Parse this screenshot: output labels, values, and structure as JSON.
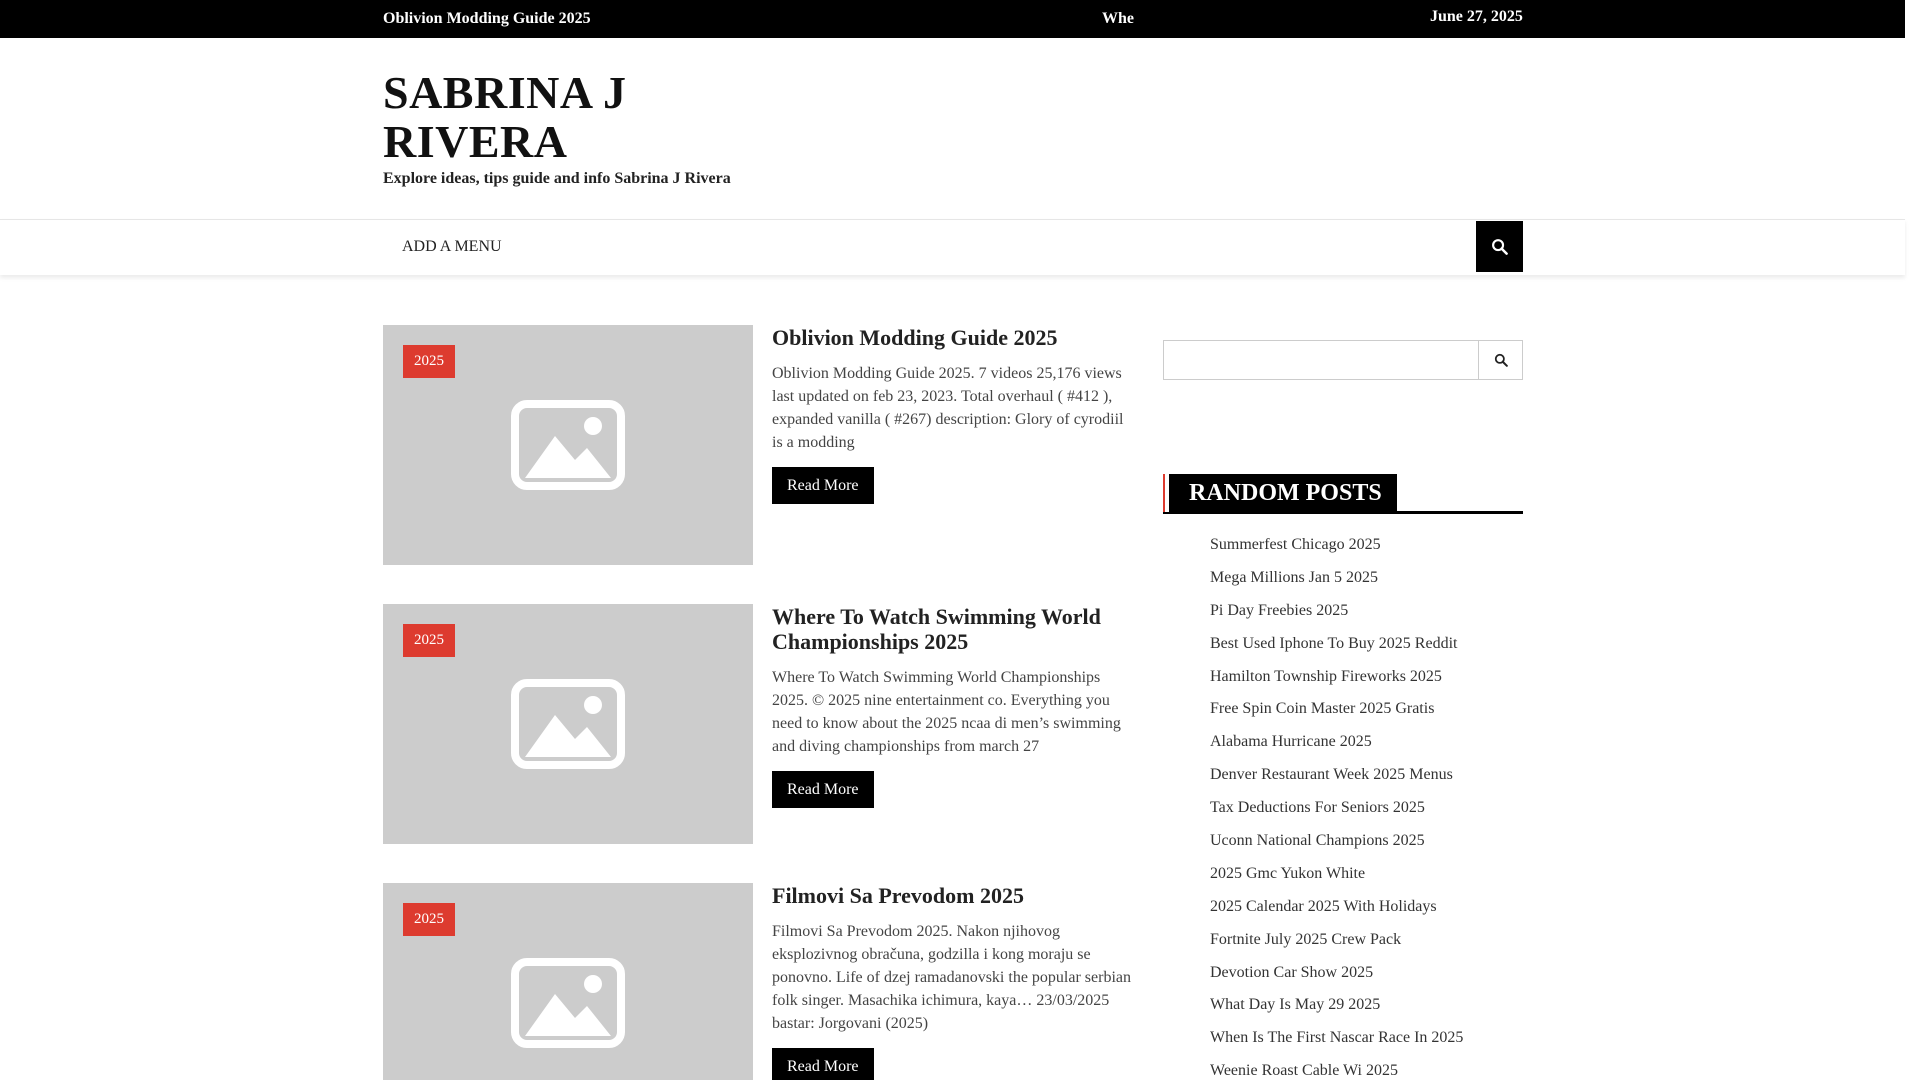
{
  "topbar": {
    "latest_title": "Oblivion Modding Guide 2025",
    "ticker_text": "Whe",
    "date": "June 27, 2025"
  },
  "site": {
    "title": "SABRINA J RIVERA",
    "tagline": "Explore ideas, tips guide and info Sabrina J Rivera"
  },
  "nav": {
    "menu_label": "ADD A MENU"
  },
  "posts": [
    {
      "category": "2025",
      "title": "Oblivion Modding Guide 2025",
      "excerpt": "Oblivion Modding Guide 2025. 7 videos 25,176 views last updated on feb 23, 2023. Total overhaul ( #412 ), expanded vanilla ( #267) description: Glory of cyrodiil is a modding",
      "read_more": "Read More"
    },
    {
      "category": "2025",
      "title": "Where To Watch Swimming World Championships 2025",
      "excerpt": "Where To Watch Swimming World Championships 2025. © 2025 nine entertainment co. Everything you need to know about the 2025 ncaa di men’s swimming and diving championships from march 27",
      "read_more": "Read More"
    },
    {
      "category": "2025",
      "title": "Filmovi Sa Prevodom 2025",
      "excerpt": "Filmovi Sa Prevodom 2025. Nakon njihovog eksplozivnog obračuna, godzilla i kong moraju se ponovno. Life of dzej ramadanovski the popular serbian folk singer. Masachika ichimura, kaya… 23/03/2025 bastar: Jorgovani (2025)",
      "read_more": "Read More"
    }
  ],
  "sidebar": {
    "search_placeholder": "",
    "random_title": "RANDOM POSTS",
    "random_posts": [
      "Summerfest Chicago 2025",
      "Mega Millions Jan 5 2025",
      "Pi Day Freebies 2025",
      "Best Used Iphone To Buy 2025 Reddit",
      "Hamilton Township Fireworks 2025",
      "Free Spin Coin Master 2025 Gratis",
      "Alabama Hurricane 2025",
      "Denver Restaurant Week 2025 Menus",
      "Tax Deductions For Seniors 2025",
      "Uconn National Champions 2025",
      "2025 Gmc Yukon White",
      "2025 Calendar 2025 With Holidays",
      "Fortnite July 2025 Crew Pack",
      "Devotion Car Show 2025",
      "What Day Is May 29 2025",
      "When Is The First Nascar Race In 2025",
      "Weenie Roast Cable Wi 2025"
    ]
  },
  "colors": {
    "accent": "#dd3b2f",
    "topbar_bg": "#000000",
    "thumb_bg": "#cccccc"
  },
  "icons": {
    "nav_search": "search-icon",
    "sidebar_search": "search-icon",
    "thumbnail": "image-placeholder-icon"
  }
}
